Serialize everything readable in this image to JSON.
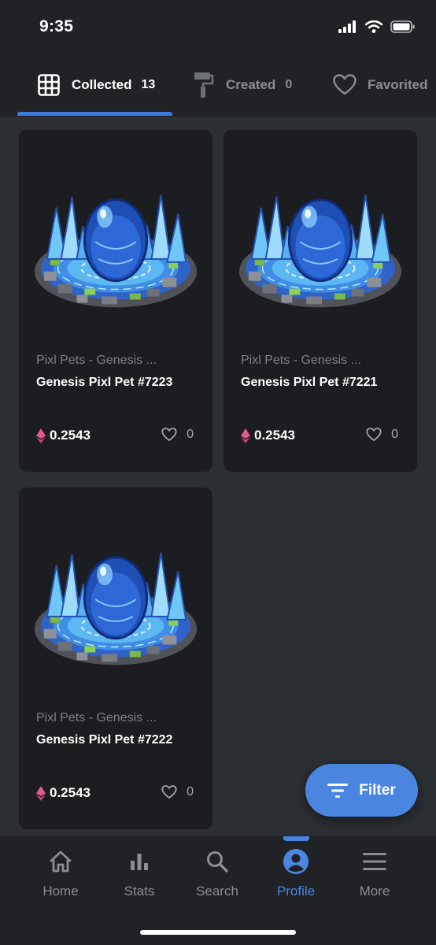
{
  "status_bar": {
    "time": "9:35"
  },
  "tabs": [
    {
      "label": "Collected",
      "count": "13",
      "icon": "grid-icon",
      "active": true
    },
    {
      "label": "Created",
      "count": "0",
      "icon": "paint-roller-icon",
      "active": false
    },
    {
      "label": "Favorited",
      "icon": "heart-outline-icon",
      "active": false
    }
  ],
  "cards": [
    {
      "collection": "Pixl Pets - Genesis ...",
      "title": "Genesis Pixl Pet #7223",
      "price": "0.2543",
      "likes": "0"
    },
    {
      "collection": "Pixl Pets - Genesis ...",
      "title": "Genesis Pixl Pet #7221",
      "price": "0.2543",
      "likes": "0"
    },
    {
      "collection": "Pixl Pets - Genesis ...",
      "title": "Genesis Pixl Pet #7222",
      "price": "0.2543",
      "likes": "0"
    }
  ],
  "filter_button": {
    "label": "Filter"
  },
  "bottom_nav": [
    {
      "label": "Home",
      "icon": "home-icon",
      "active": false
    },
    {
      "label": "Stats",
      "icon": "bar-chart-icon",
      "active": false
    },
    {
      "label": "Search",
      "icon": "search-icon",
      "active": false
    },
    {
      "label": "Profile",
      "icon": "profile-icon",
      "active": true
    },
    {
      "label": "More",
      "icon": "menu-icon",
      "active": false
    }
  ],
  "colors": {
    "background": "#2b2e32",
    "panel": "#202226",
    "card": "#1c1d20",
    "accent": "#4a86e0",
    "eth": "#e05a8a"
  }
}
